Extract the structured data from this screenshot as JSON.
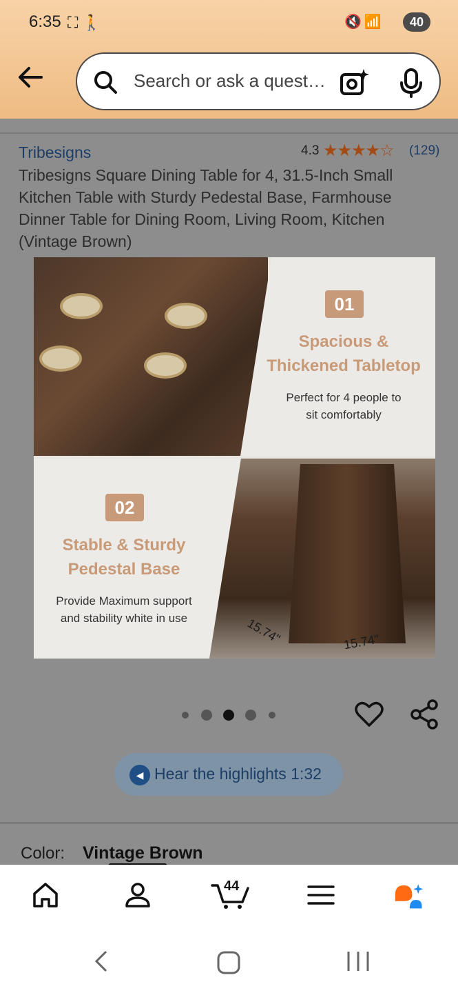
{
  "status_bar": {
    "time": "6:35",
    "battery": "40"
  },
  "search": {
    "placeholder": "Search or ask a question"
  },
  "product": {
    "brand": "Tribesigns",
    "rating": "4.3",
    "review_count": "(129)",
    "title": "Tribesigns Square Dining Table for 4, 31.5-Inch Small Kitchen Table with Sturdy Pedestal Base, Farmhouse Dinner Table for Dining Room, Living Room, Kitchen (Vintage Brown)"
  },
  "image": {
    "feature1_num": "01",
    "feature1_title_line1": "Spacious &",
    "feature1_title_line2": "Thickened Tabletop",
    "feature1_desc_line1": "Perfect for 4 people to",
    "feature1_desc_line2": "sit comfortably",
    "feature2_num": "02",
    "feature2_title_line1": "Stable & Sturdy",
    "feature2_title_line2": "Pedestal Base",
    "feature2_desc_line1": "Provide Maximum support",
    "feature2_desc_line2": "and stability white in use",
    "dim1": "15.74\"",
    "dim2": "15.74\""
  },
  "carousel": {
    "active_index": 2,
    "count": 5
  },
  "hear": {
    "label": "Hear the highlights 1:32"
  },
  "color": {
    "label": "Color:",
    "value": "Vintage Brown"
  },
  "nav": {
    "cart_count": "44"
  },
  "colors": {
    "header": "#f0bf88",
    "brand_link": "#1e3d66",
    "stars": "#a44a14",
    "accent_feature": "#c99a77"
  }
}
